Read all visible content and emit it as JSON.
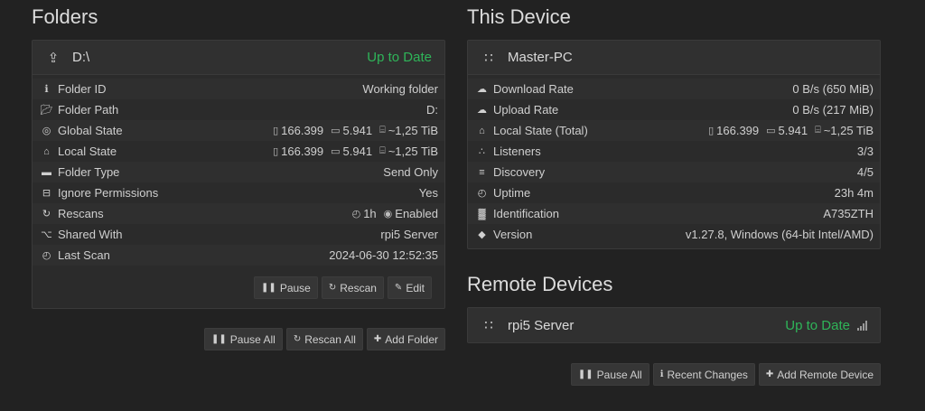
{
  "folders": {
    "heading": "Folders",
    "panel": {
      "title": "D:\\",
      "status": "Up to Date",
      "rows": [
        {
          "label": "Folder ID",
          "icon": "info-icon",
          "value": "Working folder"
        },
        {
          "label": "Folder Path",
          "icon": "folder-open-icon",
          "value": "D:"
        },
        {
          "label": "Global State",
          "icon": "globe-icon",
          "files": "166.399",
          "dirs": "5.941",
          "size": "~1,25 TiB"
        },
        {
          "label": "Local State",
          "icon": "home-icon",
          "files": "166.399",
          "dirs": "5.941",
          "size": "~1,25 TiB"
        },
        {
          "label": "Folder Type",
          "icon": "folder-icon",
          "value": "Send Only"
        },
        {
          "label": "Ignore Permissions",
          "icon": "minus-square-icon",
          "value": "Yes"
        },
        {
          "label": "Rescans",
          "icon": "refresh-icon",
          "interval": "1h",
          "watch": "Enabled"
        },
        {
          "label": "Shared With",
          "icon": "share-icon",
          "value": "rpi5 Server"
        },
        {
          "label": "Last Scan",
          "icon": "clock-icon",
          "value": "2024-06-30 12:52:35"
        }
      ],
      "buttons": {
        "pause": "Pause",
        "rescan": "Rescan",
        "edit": "Edit"
      }
    },
    "actions": {
      "pause_all": "Pause All",
      "rescan_all": "Rescan All",
      "add_folder": "Add Folder"
    }
  },
  "device": {
    "heading": "This Device",
    "panel": {
      "title": "Master-PC",
      "rows": [
        {
          "label": "Download Rate",
          "icon": "cloud-download-icon",
          "value": "0 B/s (650 MiB)"
        },
        {
          "label": "Upload Rate",
          "icon": "cloud-upload-icon",
          "value": "0 B/s (217 MiB)"
        },
        {
          "label": "Local State (Total)",
          "icon": "home-icon",
          "files": "166.399",
          "dirs": "5.941",
          "size": "~1,25 TiB"
        },
        {
          "label": "Listeners",
          "icon": "sitemap-icon",
          "value": "3/3"
        },
        {
          "label": "Discovery",
          "icon": "signpost-icon",
          "value": "4/5"
        },
        {
          "label": "Uptime",
          "icon": "clock-icon",
          "value": "23h 4m"
        },
        {
          "label": "Identification",
          "icon": "qrcode-icon",
          "value": "A735ZTH"
        },
        {
          "label": "Version",
          "icon": "tag-icon",
          "value": "v1.27.8, Windows (64-bit Intel/AMD)"
        }
      ]
    }
  },
  "remote": {
    "heading": "Remote Devices",
    "device_name": "rpi5 Server",
    "status": "Up to Date",
    "actions": {
      "pause_all": "Pause All",
      "recent_changes": "Recent Changes",
      "add_remote": "Add Remote Device"
    }
  },
  "colors": {
    "accent_green": "#2fb559",
    "link_blue": "#3a8ee0",
    "background": "#222222"
  }
}
